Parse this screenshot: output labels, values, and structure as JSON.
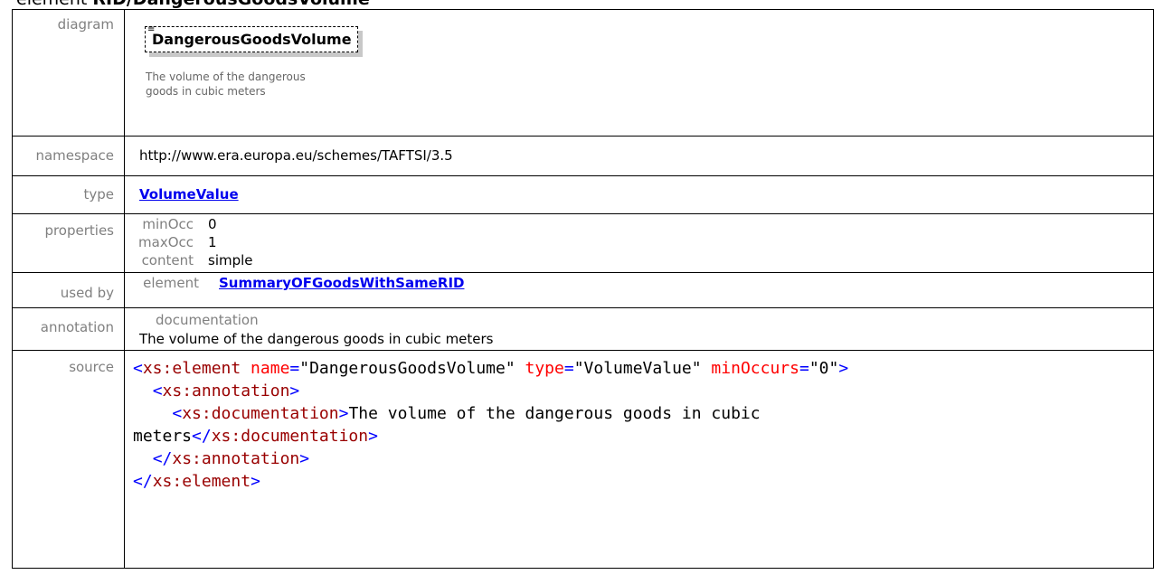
{
  "heading": {
    "prefix": "element ",
    "name": "RID/DangerousGoodsVolume"
  },
  "rows": {
    "diagram": {
      "label": "diagram",
      "element_name": "DangerousGoodsVolume",
      "doc": "The volume of the dangerous goods in cubic meters"
    },
    "namespace": {
      "label": "namespace",
      "value": "http://www.era.europa.eu/schemes/TAFTSI/3.5"
    },
    "type": {
      "label": "type",
      "value": "VolumeValue"
    },
    "properties": {
      "label": "properties",
      "items": [
        {
          "key": "minOcc",
          "value": "0"
        },
        {
          "key": "maxOcc",
          "value": "1"
        },
        {
          "key": "content",
          "value": "simple"
        }
      ]
    },
    "used_by": {
      "label": "used by",
      "kind": "element",
      "value": "SummaryOFGoodsWithSameRID"
    },
    "annotation": {
      "label": "annotation",
      "key": "documentation",
      "value": "The volume of the dangerous goods in cubic meters"
    },
    "source": {
      "label": "source",
      "tokens": {
        "open_lt": "<",
        "tag_element": "xs:element",
        "attr_name": " name",
        "eq": "=",
        "name_val": "\"DangerousGoodsVolume\"",
        "attr_type": " type",
        "type_val": "\"VolumeValue\"",
        "attr_min": " minOccurs",
        "min_val": "\"0\"",
        "gt": ">",
        "tag_annotation": "xs:annotation",
        "tag_documentation": "xs:documentation",
        "doc_text_1": "The volume of the dangerous goods in cubic",
        "doc_text_2": "meters",
        "close_lt": "</"
      }
    }
  }
}
